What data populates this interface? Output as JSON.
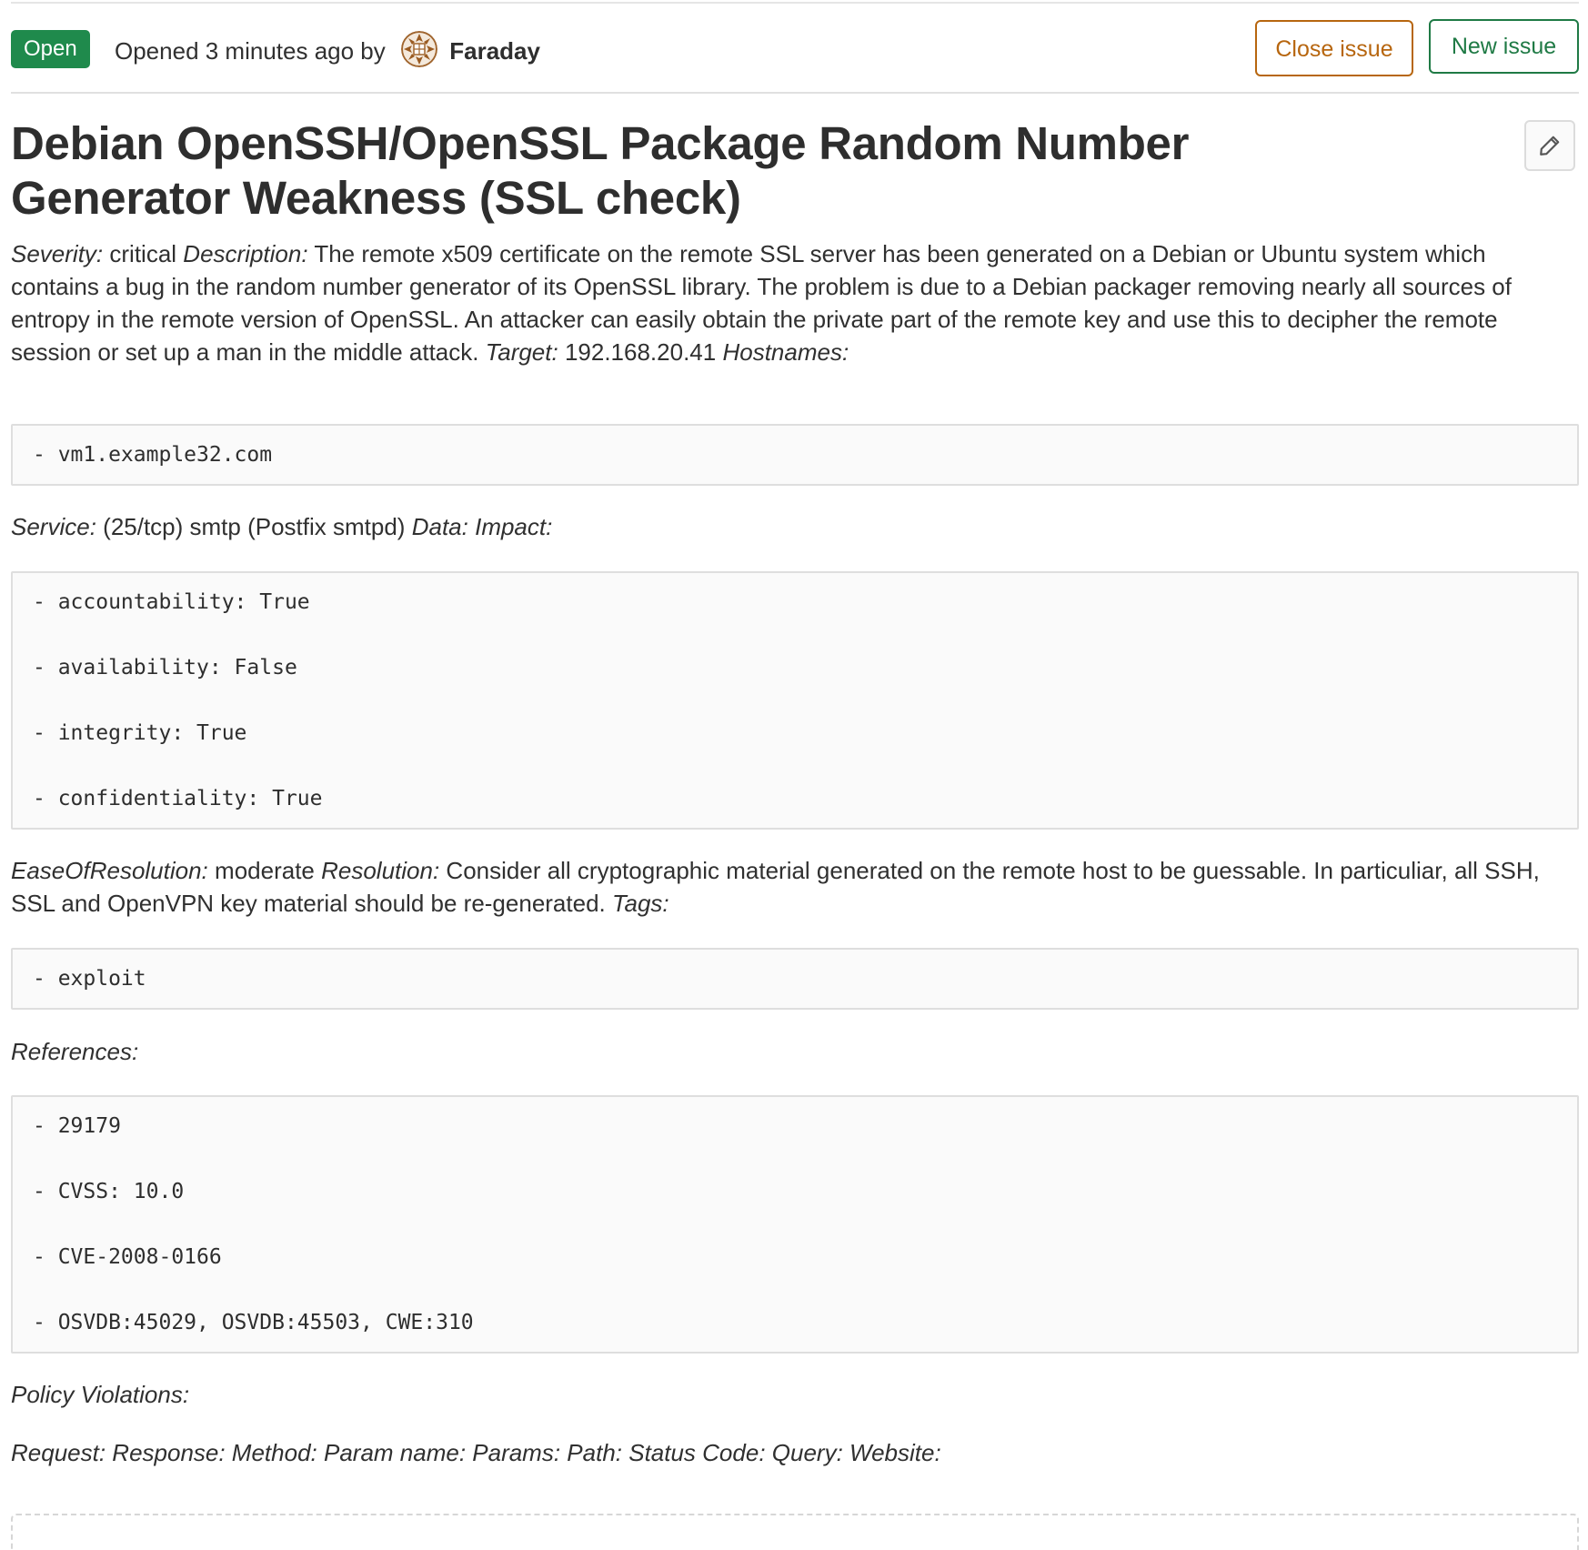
{
  "header": {
    "status": "Open",
    "opened_text": "Opened 3 minutes ago by",
    "author": "Faraday",
    "close_button": "Close issue",
    "new_button": "New issue"
  },
  "issue": {
    "title": "Debian OpenSSH/OpenSSL Package Random Number Generator Weakness (SSL check)",
    "edit_icon": "pencil-icon",
    "description": {
      "severity_label": "Severity:",
      "severity_value": "critical",
      "description_label": "Description:",
      "description_value": "The remote x509 certificate on the remote SSL server has been generated on a Debian or Ubuntu system which contains a bug in the random number generator of its OpenSSL library. The problem is due to a Debian packager removing nearly all sources of entropy in the remote version of OpenSSL. An attacker can easily obtain the private part of the remote key and use this to decipher the remote session or set up a man in the middle attack.",
      "target_label": "Target:",
      "target_value": "192.168.20.41",
      "hostnames_label": "Hostnames:",
      "hostnames": [
        "- vm1.example32.com"
      ],
      "service_label": "Service:",
      "service_value": "(25/tcp) smtp (Postfix smtpd)",
      "data_label": "Data:",
      "impact_label": "Impact:",
      "impact": [
        "- accountability: True",
        "- availability: False",
        "- integrity: True",
        "- confidentiality: True"
      ],
      "ease_label": "EaseOfResolution:",
      "ease_value": "moderate",
      "resolution_label": "Resolution:",
      "resolution_value": "Consider all cryptographic material generated on the remote host to be guessable. In particuliar, all SSH, SSL and OpenVPN key material should be re-generated.",
      "tags_label": "Tags:",
      "tags": [
        "- exploit"
      ],
      "references_label": "References:",
      "references": [
        "- 29179",
        "- CVSS: 10.0",
        "- CVE-2008-0166",
        "- OSVDB:45029, OSVDB:45503, CWE:310"
      ],
      "policy_label": "Policy Violations:",
      "request_line": "Request: Response: Method: Param name: Params: Path: Status Code: Query: Website:"
    }
  },
  "colors": {
    "status_green": "#1f8a4c",
    "close_orange": "#b7660f",
    "new_green": "#1f7a45"
  }
}
